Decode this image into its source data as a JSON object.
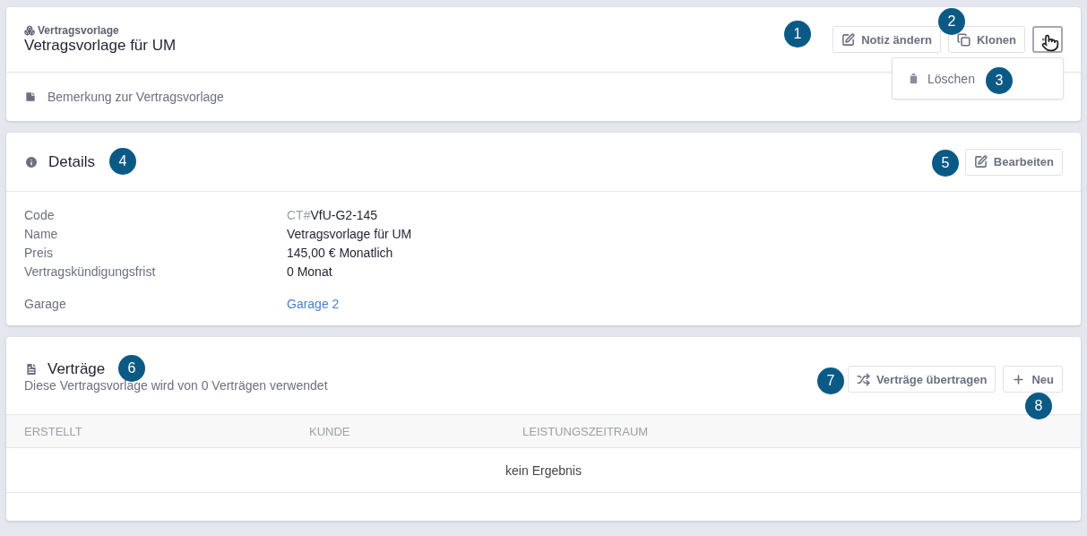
{
  "header": {
    "type_label": "Vertragsvorlage",
    "title": "Vetragsvorlage für UM",
    "buttons": [
      {
        "kind": "edit",
        "label": "Notiz ändern"
      },
      {
        "kind": "clone",
        "label": "Klonen"
      },
      {
        "kind": "more"
      }
    ],
    "menu": [
      {
        "kind": "delete",
        "label": "Löschen"
      }
    ],
    "note": "Bemerkung zur Vertragsvorlage"
  },
  "details": {
    "title": "Details",
    "button": {
      "kind": "edit",
      "label": "Bearbeiten"
    },
    "fields": [
      {
        "label": "Code",
        "prefix": "CT#",
        "value": "VfU-G2-145",
        "kind": "text"
      },
      {
        "label": "Name",
        "value": "Vetragsvorlage für UM",
        "kind": "text"
      },
      {
        "label": "Preis",
        "value": "145,00 € Monatlich",
        "kind": "text"
      },
      {
        "label": "Vertragskündigungsfrist",
        "value": "0 Monat",
        "kind": "text"
      },
      {
        "label": "Garage",
        "value": "Garage 2",
        "kind": "link"
      }
    ]
  },
  "contracts": {
    "title": "Verträge",
    "subtitle": "Diese Vertragsvorlage wird von 0 Verträgen verwendet",
    "buttons": [
      {
        "kind": "transfer",
        "label": "Verträge übertragen"
      },
      {
        "kind": "add",
        "label": "Neu"
      }
    ],
    "table": {
      "columns": [
        "ERSTELLT",
        "KUNDE",
        "LEISTUNGSZEITRAUM"
      ],
      "empty_text": "kein Ergebnis"
    }
  },
  "callouts": [
    "1",
    "2",
    "3",
    "4",
    "5",
    "6",
    "7",
    "8"
  ]
}
